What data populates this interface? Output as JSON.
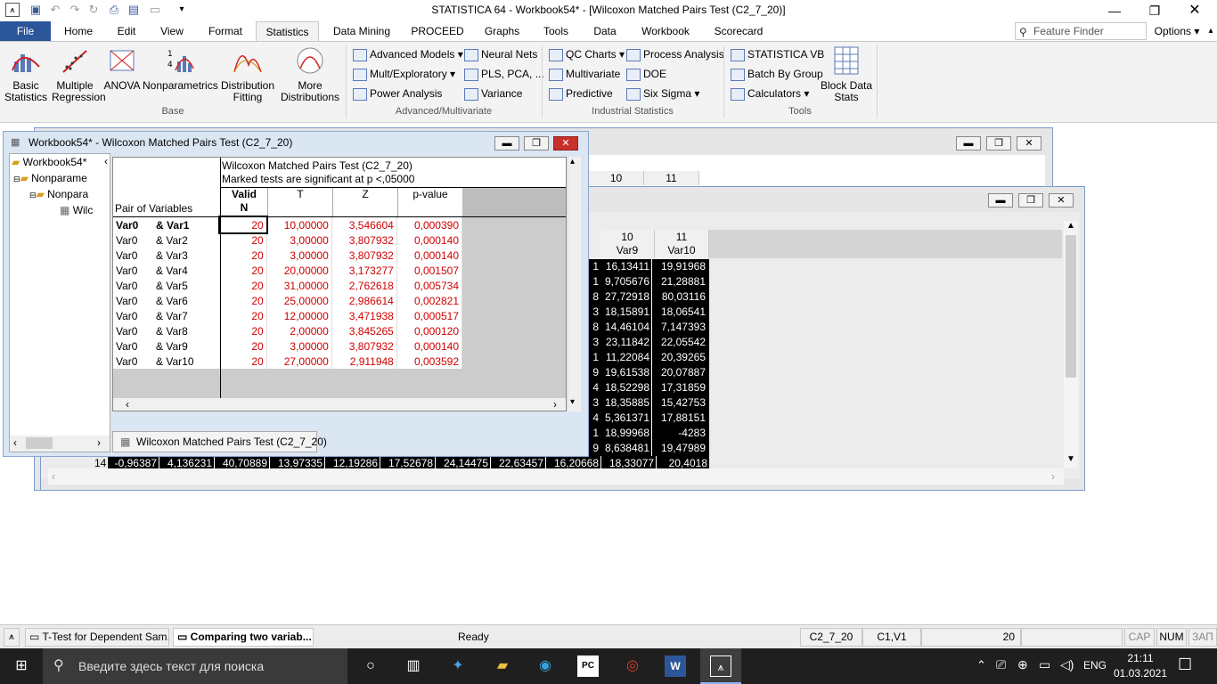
{
  "app": {
    "title": "STATISTICA 64 - Workbook54* - [Wilcoxon Matched Pairs Test (C2_7_20)]"
  },
  "tabs": [
    "File",
    "Home",
    "Edit",
    "View",
    "Format",
    "Statistics",
    "Data Mining",
    "PROCEED",
    "Graphs",
    "Tools",
    "Data",
    "Workbook",
    "Scorecard"
  ],
  "active_tab": "Statistics",
  "feature_finder": {
    "placeholder": "Feature Finder"
  },
  "options_label": "Options",
  "ribbon": {
    "base_buttons": [
      {
        "label": "Basic\nStatistics",
        "icon": "basic-statistics-icon"
      },
      {
        "label": "Multiple\nRegression",
        "icon": "regression-icon"
      },
      {
        "label": "ANOVA",
        "icon": "anova-icon"
      },
      {
        "label": "Nonparametrics",
        "icon": "nonparametrics-icon"
      },
      {
        "label": "Distribution\nFitting",
        "icon": "distribution-icon"
      },
      {
        "label": "More\nDistributions",
        "icon": "more-distributions-icon"
      }
    ],
    "group_base": "Base",
    "adv": [
      "Advanced Models",
      "Neural Nets",
      "Mult/Exploratory",
      "PLS, PCA, ...",
      "Power Analysis",
      "Variance"
    ],
    "group_adv": "Advanced/Multivariate",
    "ind": [
      "QC Charts",
      "Process Analysis",
      "Multivariate",
      "DOE",
      "Predictive",
      "Six Sigma"
    ],
    "group_ind": "Industrial Statistics",
    "tools": [
      "STATISTICA VB",
      "Batch By Group",
      "Calculators",
      "Block Data\nStats"
    ],
    "group_tools": "Tools"
  },
  "result_window": {
    "title": "Workbook54* - Wilcoxon Matched Pairs Test (C2_7_20)",
    "tree": [
      "Workbook54*",
      "Nonparame",
      "Nonpara",
      "Wilc"
    ],
    "header1": "Wilcoxon Matched Pairs Test (C2_7_20)",
    "header2": "Marked tests are significant at p <,05000",
    "col_pair": "Pair of Variables",
    "cols": [
      "Valid\nN",
      "T",
      "Z",
      "p-value"
    ],
    "rows": [
      [
        "Var0",
        "& Var1",
        "20",
        "10,00000",
        "3,546604",
        "0,000390"
      ],
      [
        "Var0",
        "& Var2",
        "20",
        "3,00000",
        "3,807932",
        "0,000140"
      ],
      [
        "Var0",
        "& Var3",
        "20",
        "3,00000",
        "3,807932",
        "0,000140"
      ],
      [
        "Var0",
        "& Var4",
        "20",
        "20,00000",
        "3,173277",
        "0,001507"
      ],
      [
        "Var0",
        "& Var5",
        "20",
        "31,00000",
        "2,762618",
        "0,005734"
      ],
      [
        "Var0",
        "& Var6",
        "20",
        "25,00000",
        "2,986614",
        "0,002821"
      ],
      [
        "Var0",
        "& Var7",
        "20",
        "12,00000",
        "3,471938",
        "0,000517"
      ],
      [
        "Var0",
        "& Var8",
        "20",
        "2,00000",
        "3,845265",
        "0,000120"
      ],
      [
        "Var0",
        "& Var9",
        "20",
        "3,00000",
        "3,807932",
        "0,000140"
      ],
      [
        "Var0",
        "& Var10",
        "20",
        "27,00000",
        "2,911948",
        "0,003592"
      ]
    ],
    "sheet_tab": "Wilcoxon Matched Pairs Test (C2_7_20)"
  },
  "data_sheet": {
    "col_hdr_back": [
      "10",
      "11"
    ],
    "col_nums": [
      "10",
      "11"
    ],
    "col_names": [
      "Var9",
      "Var10"
    ],
    "left_digits": [
      "1",
      "1",
      "8",
      "3",
      "8",
      "3",
      "1",
      "9",
      "4",
      "3",
      "4",
      "1",
      "9"
    ],
    "var9": [
      "16,13411",
      "9,705676",
      "27,72918",
      "18,15891",
      "14,46104",
      "23,11842",
      "11,22084",
      "19,61538",
      "18,52298",
      "18,35885",
      "5,361371",
      "18,99968",
      "8,638481"
    ],
    "var10": [
      "19,91968",
      "21,28881",
      "80,03116",
      "18,06541",
      "7,147393",
      "22,05542",
      "20,39265",
      "20,07887",
      "17,31859",
      "15,42753",
      "17,88151",
      "-4283",
      "19,47989"
    ],
    "row14": [
      "14",
      "-0,96387",
      "4,136231",
      "40,70889",
      "13,97335",
      "12,19286",
      "17,52678",
      "24,14475",
      "22,63457",
      "16,20668",
      "18,33077",
      "20,4018"
    ]
  },
  "status": {
    "ready": "Ready",
    "cells": [
      "C2_7_20",
      "C1,V1",
      "20",
      "CAP",
      "NUM",
      "ЗАП"
    ]
  },
  "taskbar_tasks": [
    "T-Test for Dependent Sam...",
    "Comparing two variab..."
  ],
  "taskbar": {
    "search": "Введите здесь текст для поиска",
    "lang": "ENG",
    "time": "21:11",
    "date": "01.03.2021"
  }
}
